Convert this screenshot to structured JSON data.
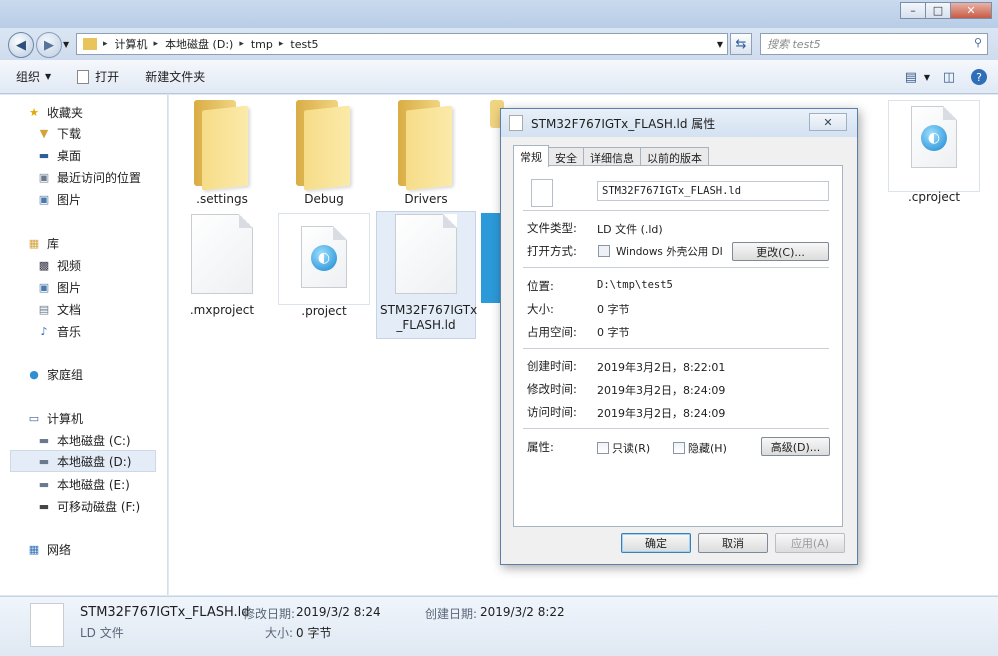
{
  "window": {
    "minimize": "–",
    "maximize": "□",
    "close": "✕"
  },
  "address": {
    "crumbs": [
      "计算机",
      "本地磁盘 (D:)",
      "tmp",
      "test5"
    ],
    "search_placeholder": "搜索 test5"
  },
  "toolbar": {
    "organize": "组织",
    "open": "打开",
    "new_folder": "新建文件夹"
  },
  "nav": {
    "favorites": "收藏夹",
    "downloads": "下载",
    "desktop": "桌面",
    "recent": "最近访问的位置",
    "pictures_fav": "图片",
    "libraries": "库",
    "videos": "视频",
    "pictures": "图片",
    "documents": "文档",
    "music": "音乐",
    "homegroup": "家庭组",
    "computer": "计算机",
    "drive_c": "本地磁盘 (C:)",
    "drive_d": "本地磁盘 (D:)",
    "drive_e": "本地磁盘 (E:)",
    "drive_f": "可移动磁盘 (F:)",
    "network": "网络"
  },
  "files": {
    "settings": ".settings",
    "debug": "Debug",
    "drivers": "Drivers",
    "cproject": ".cproject",
    "mxproject": ".mxproject",
    "project": ".project",
    "ld_line1": "STM32F767IGTx",
    "ld_line2": "_FLASH.ld"
  },
  "details": {
    "name": "STM32F767IGTx_FLASH.ld",
    "type": "LD 文件",
    "modified_label": "修改日期:",
    "modified": "2019/3/2 8:24",
    "created_label": "创建日期:",
    "created": "2019/3/2 8:22",
    "size_label": "大小:",
    "size": "0 字节"
  },
  "dialog": {
    "title": "STM32F767IGTx_FLASH.ld 属性",
    "tabs": [
      "常规",
      "安全",
      "详细信息",
      "以前的版本"
    ],
    "filename": "STM32F767IGTx_FLASH.ld",
    "type_label": "文件类型:",
    "type_value": "LD 文件 (.ld)",
    "opens_label": "打开方式:",
    "opens_value": "Windows 外壳公用 DI",
    "change_btn": "更改(C)...",
    "location_label": "位置:",
    "location_value": "D:\\tmp\\test5",
    "size_label": "大小:",
    "size_value": "0 字节",
    "disk_label": "占用空间:",
    "disk_value": "0 字节",
    "created_label": "创建时间:",
    "created_value": "2019年3月2日，8:22:01",
    "modified_label": "修改时间:",
    "modified_value": "2019年3月2日，8:24:09",
    "accessed_label": "访问时间:",
    "accessed_value": "2019年3月2日，8:24:09",
    "attr_label": "属性:",
    "readonly": "只读(R)",
    "hidden": "隐藏(H)",
    "advanced_btn": "高级(D)...",
    "ok": "确定",
    "cancel": "取消",
    "apply": "应用(A)"
  }
}
